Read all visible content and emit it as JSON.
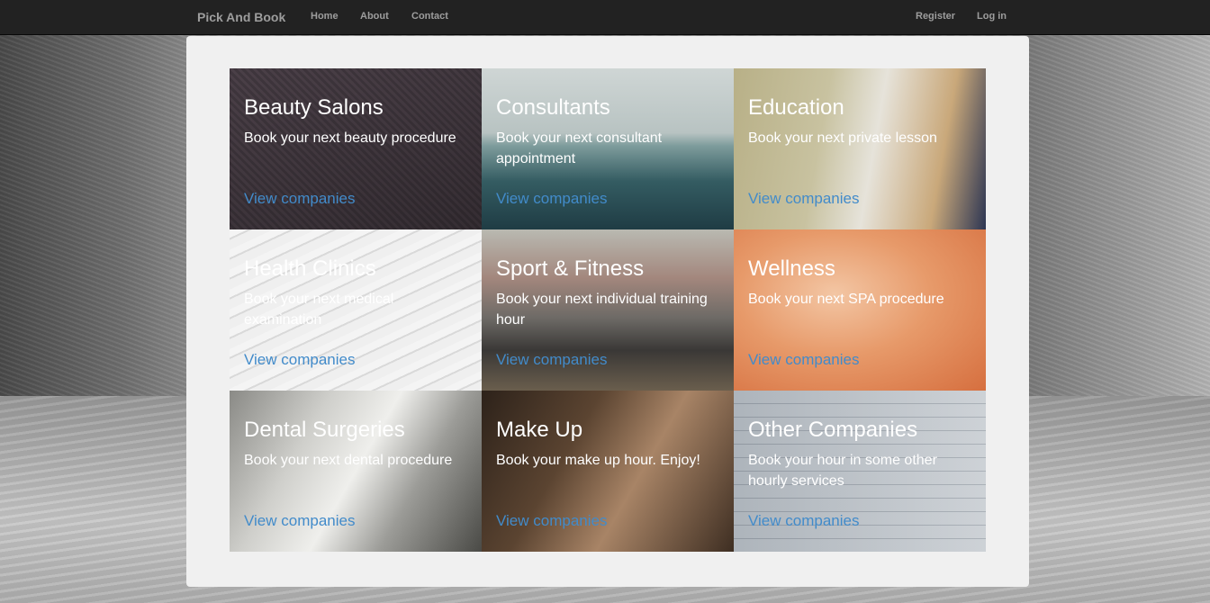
{
  "navbar": {
    "brand": "Pick And Book",
    "links": [
      "Home",
      "About",
      "Contact"
    ],
    "register": "Register",
    "login": "Log in"
  },
  "categories": [
    {
      "title": "Beauty Salons",
      "description": "Book your next beauty procedure",
      "link": "View companies"
    },
    {
      "title": "Consultants",
      "description": "Book your next consultant appointment",
      "link": "View companies"
    },
    {
      "title": "Education",
      "description": "Book your next private lesson",
      "link": "View companies"
    },
    {
      "title": "Health Clinics",
      "description": "Book your next medical examination",
      "link": "View companies"
    },
    {
      "title": "Sport & Fitness",
      "description": "Book your next individual training hour",
      "link": "View companies"
    },
    {
      "title": "Wellness",
      "description": "Book your next SPA procedure",
      "link": "View companies"
    },
    {
      "title": "Dental Surgeries",
      "description": "Book your next dental procedure",
      "link": "View companies"
    },
    {
      "title": "Make Up",
      "description": "Book your make up hour. Enjoy!",
      "link": "View companies"
    },
    {
      "title": "Other Companies",
      "description": "Book your hour in some other hourly services",
      "link": "View companies"
    }
  ],
  "colors": {
    "navbar_bg": "#222222",
    "nav_text": "#9d9d9d",
    "link": "#428bca",
    "panel_bg": "#f0f0f0"
  }
}
